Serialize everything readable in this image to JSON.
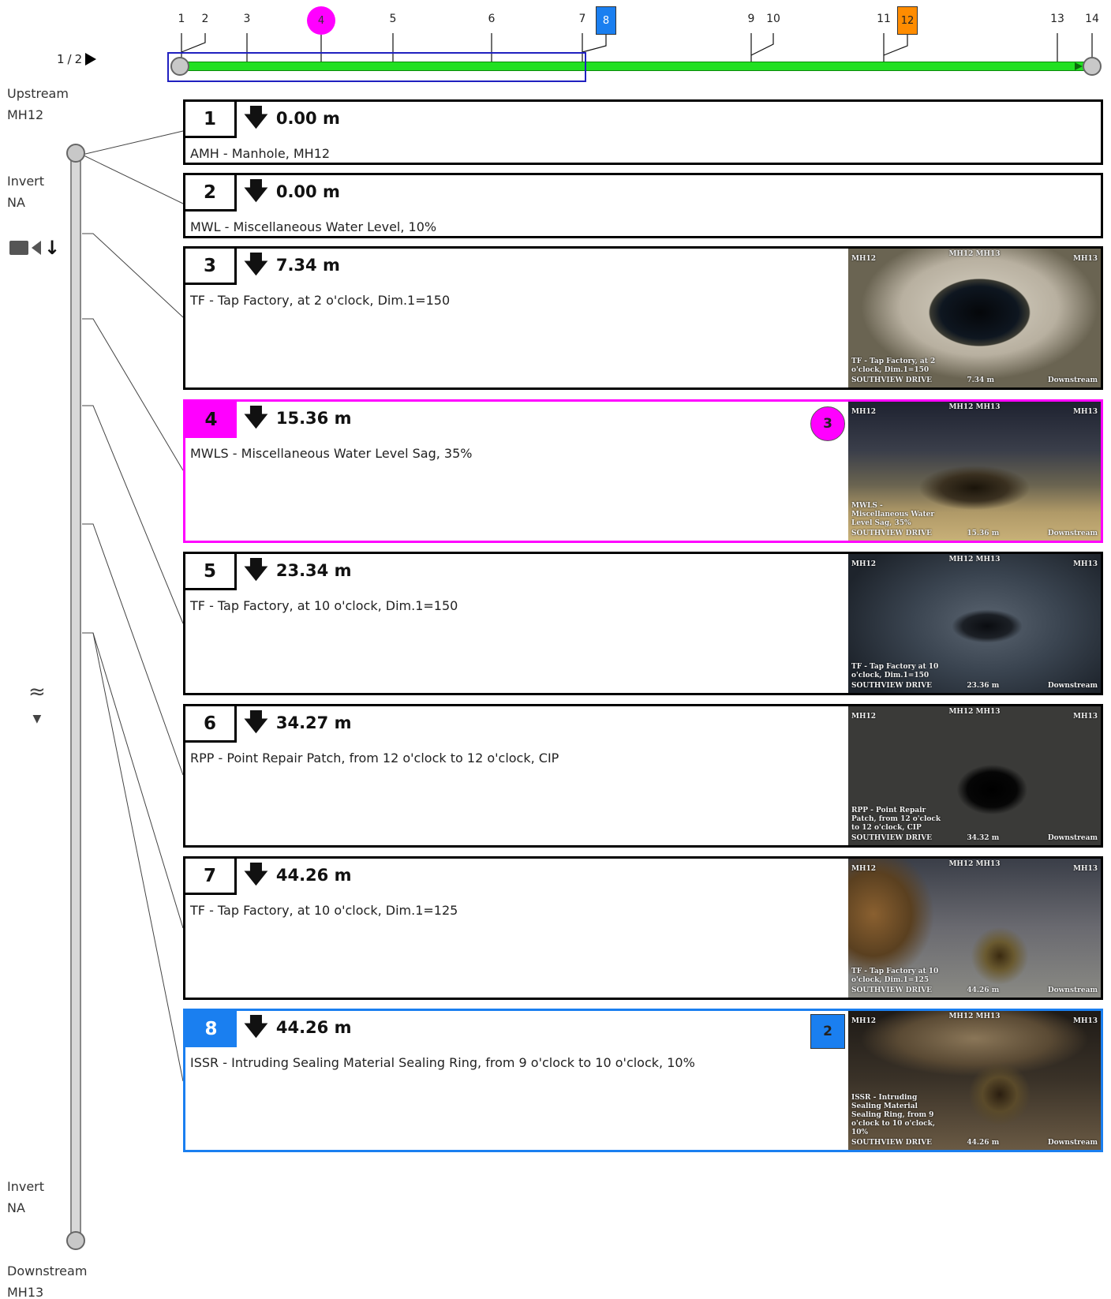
{
  "pager": {
    "current": "1",
    "separator": "/",
    "total": "2"
  },
  "timeline": {
    "markers": [
      {
        "label": "1",
        "style": "plain"
      },
      {
        "label": "2",
        "style": "plain"
      },
      {
        "label": "3",
        "style": "plain"
      },
      {
        "label": "4",
        "style": "magenta-circle"
      },
      {
        "label": "5",
        "style": "plain"
      },
      {
        "label": "6",
        "style": "plain"
      },
      {
        "label": "7",
        "style": "plain"
      },
      {
        "label": "8",
        "style": "blue-square"
      },
      {
        "label": "9",
        "style": "plain"
      },
      {
        "label": "10",
        "style": "plain"
      },
      {
        "label": "11",
        "style": "plain"
      },
      {
        "label": "12",
        "style": "orange-square"
      },
      {
        "label": "13",
        "style": "plain"
      },
      {
        "label": "14",
        "style": "plain"
      }
    ],
    "pipe_color": "#22e022",
    "window_color": "#2020c0"
  },
  "side": {
    "upstream_label": "Upstream",
    "upstream_mh": "MH12",
    "invert_top_label": "Invert",
    "invert_top_value": "NA",
    "invert_bottom_label": "Invert",
    "invert_bottom_value": "NA",
    "downstream_label": "Downstream",
    "downstream_mh": "MH13"
  },
  "observations": [
    {
      "num": "1",
      "distance": "0.00 m",
      "description": "AMH - Manhole, MH12"
    },
    {
      "num": "2",
      "distance": "0.00 m",
      "description": "MWL - Miscellaneous Water Level, 10%"
    },
    {
      "num": "3",
      "distance": "7.34 m",
      "description": "TF - Tap Factory, at 2 o'clock, Dim.1=150",
      "photo": {
        "top_left": "MH12",
        "top_center": "MH12 MH13",
        "top_right": "MH13",
        "caption": "TF - Tap Factory, at 2 o'clock, Dim.1=150",
        "street": "SOUTHVIEW DRIVE",
        "distance": "7.34 m",
        "direction": "Downstream"
      }
    },
    {
      "num": "4",
      "distance": "15.36 m",
      "description": "MWLS - Miscellaneous Water Level Sag, 35%",
      "marker": "3",
      "photo": {
        "top_left": "MH12",
        "top_center": "MH12 MH13",
        "top_right": "MH13",
        "caption": "MWLS - Miscellaneous Water Level Sag, 35%",
        "street": "SOUTHVIEW DRIVE",
        "distance": "15.36 m",
        "direction": "Downstream"
      }
    },
    {
      "num": "5",
      "distance": "23.34 m",
      "description": "TF - Tap Factory, at 10 o'clock, Dim.1=150",
      "photo": {
        "top_left": "MH12",
        "top_center": "MH12 MH13",
        "top_right": "MH13",
        "caption": "TF - Tap Factory at 10 o'clock, Dim.1=150",
        "street": "SOUTHVIEW DRIVE",
        "distance": "23.36 m",
        "direction": "Downstream"
      }
    },
    {
      "num": "6",
      "distance": "34.27 m",
      "description": "RPP - Point Repair Patch, from 12 o'clock to 12 o'clock, CIP",
      "photo": {
        "top_left": "MH12",
        "top_center": "MH12 MH13",
        "top_right": "MH13",
        "caption": "RPP - Point Repair Patch, from 12 o'clock to 12 o'clock, CIP",
        "street": "SOUTHVIEW DRIVE",
        "distance": "34.32 m",
        "direction": "Downstream"
      }
    },
    {
      "num": "7",
      "distance": "44.26 m",
      "description": "TF - Tap Factory, at 10 o'clock, Dim.1=125",
      "photo": {
        "top_left": "MH12",
        "top_center": "MH12 MH13",
        "top_right": "MH13",
        "caption": "TF - Tap Factory at 10 o'clock, Dim.1=125",
        "street": "SOUTHVIEW DRIVE",
        "distance": "44.26 m",
        "direction": "Downstream"
      }
    },
    {
      "num": "8",
      "distance": "44.26 m",
      "description": "ISSR - Intruding Sealing Material Sealing Ring, from 9 o'clock to 10 o'clock, 10%",
      "marker": "2",
      "photo": {
        "top_left": "MH12",
        "top_center": "MH12 MH13",
        "top_right": "MH13",
        "caption": "ISSR - Intruding Sealing Material Sealing Ring, from 9 o'clock to 10 o'clock, 10%",
        "street": "SOUTHVIEW DRIVE",
        "distance": "44.26 m",
        "direction": "Downstream"
      }
    }
  ],
  "colors": {
    "highlight_magenta": "#ff00ff",
    "highlight_blue": "#1a7ff0",
    "highlight_orange": "#ff8c00"
  },
  "icons": {
    "camera": "camera-icon",
    "direction": "down-arrow-icon",
    "flow": "flow-icon"
  }
}
